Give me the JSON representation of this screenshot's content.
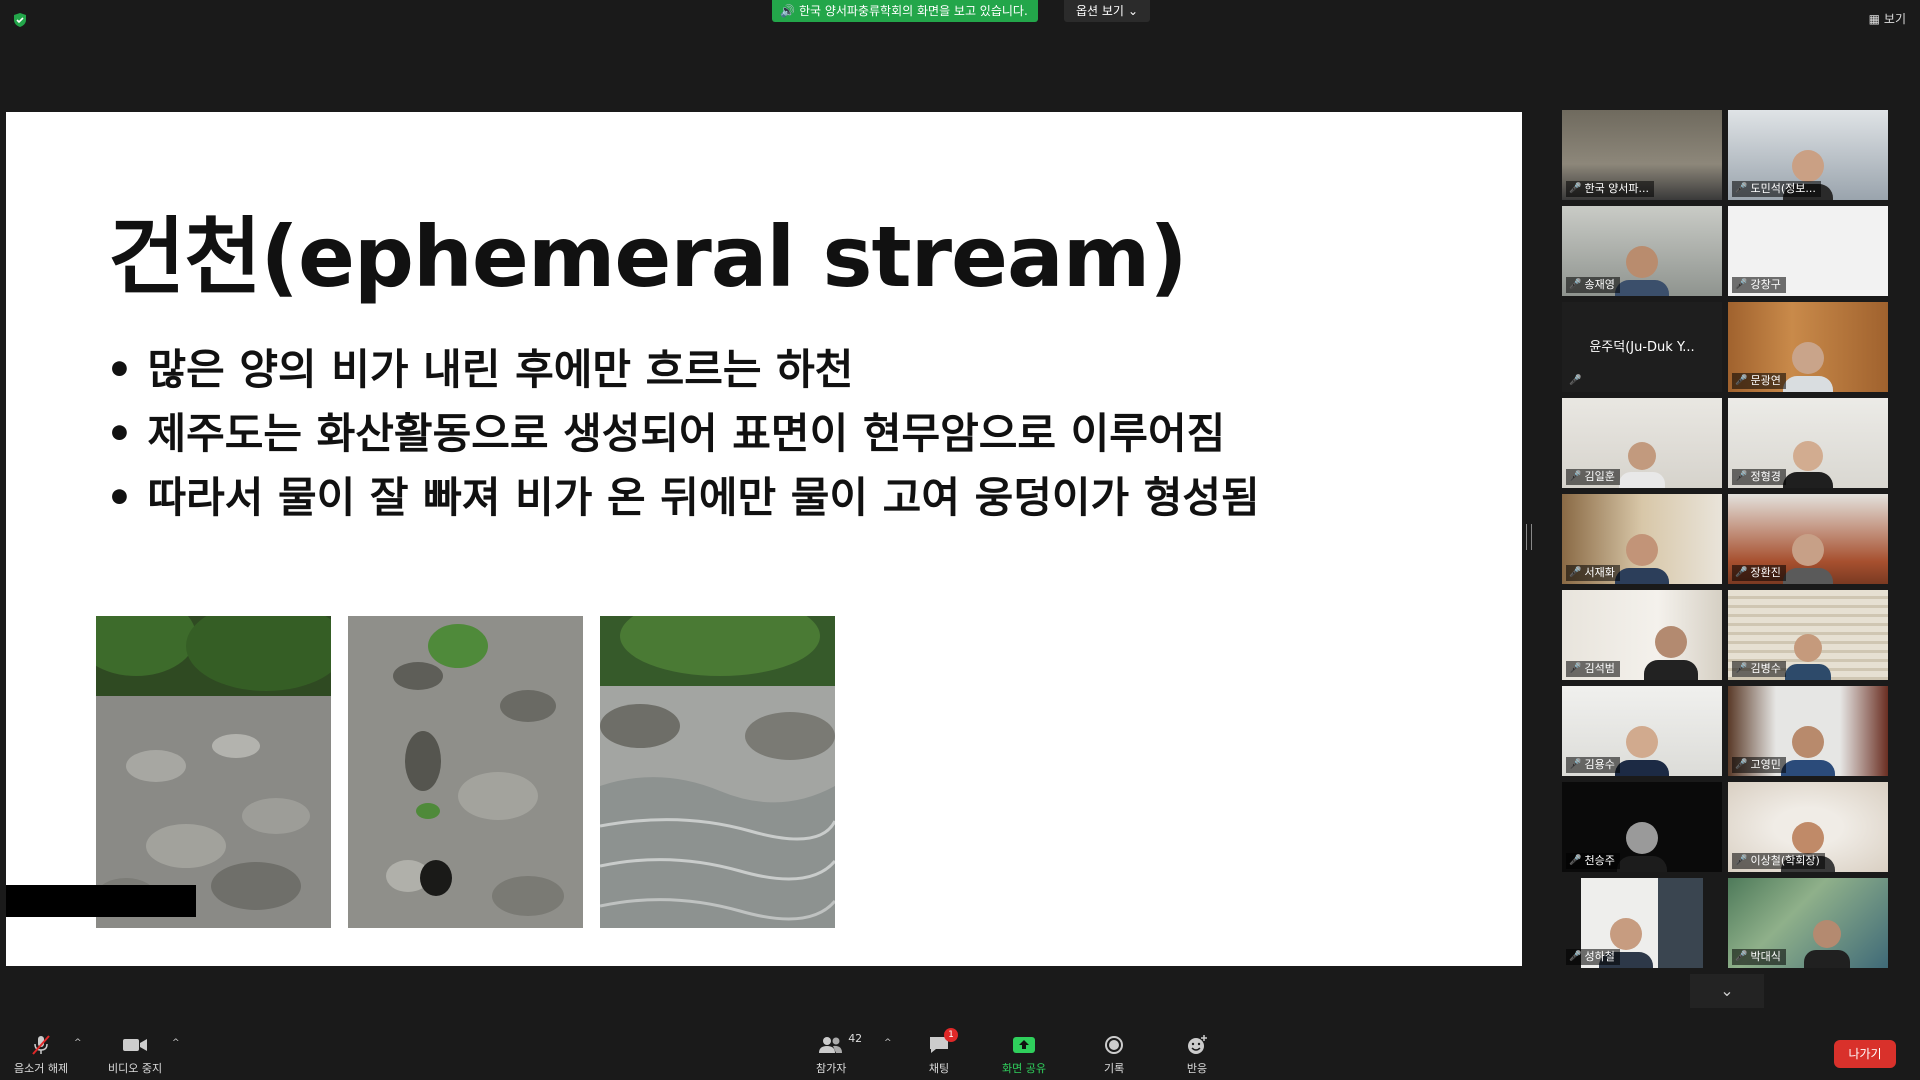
{
  "top_bar": {
    "share_banner": "한국 양서파충류학회의 화면을 보고 있습니다.",
    "view_options": "옵션 보기",
    "view_label": "보기"
  },
  "slide": {
    "title": "건천(ephemeral stream)",
    "bullets": [
      "많은 양의 비가 내린 후에만 흐르는 하천",
      "제주도는 화산활동으로 생성되어 표면이 현무암으로 이루어짐",
      "따라서 물이 잘 빠져 비가 온 뒤에만 물이 고여 웅덩이가 형성됨"
    ]
  },
  "participants": [
    {
      "name": "한국 양서파...",
      "muted": true
    },
    {
      "name": "도민석(정보...",
      "muted": true
    },
    {
      "name": "송재영",
      "muted": true,
      "active": true
    },
    {
      "name": "강창구",
      "muted": true
    },
    {
      "name": "윤주덕(Ju-Duk Y...",
      "muted": true,
      "video_off": true
    },
    {
      "name": "문광연",
      "muted": true
    },
    {
      "name": "김일훈",
      "muted": true
    },
    {
      "name": "정형경",
      "muted": true
    },
    {
      "name": "서재화",
      "muted": true
    },
    {
      "name": "장환진",
      "muted": true
    },
    {
      "name": "김석범",
      "muted": true
    },
    {
      "name": "김병수",
      "muted": true
    },
    {
      "name": "김용수",
      "muted": true
    },
    {
      "name": "고영민",
      "muted": true
    },
    {
      "name": "천승주",
      "muted": true
    },
    {
      "name": "이상철(학회장)",
      "muted": true
    },
    {
      "name": "성하철",
      "muted": true
    },
    {
      "name": "박대식",
      "muted": true
    }
  ],
  "toolbar": {
    "unmute": "음소거 해제",
    "stop_video": "비디오 중지",
    "participants": "참가자",
    "participant_count": "42",
    "chat": "채팅",
    "chat_badge": "1",
    "share_screen": "화면 공유",
    "record": "기록",
    "reactions": "반응",
    "leave": "나가기"
  },
  "colors": {
    "share_green": "#23a64a",
    "active_speaker": "#c8e84a",
    "leave_red": "#d9312b",
    "mute_red": "#e02828"
  }
}
